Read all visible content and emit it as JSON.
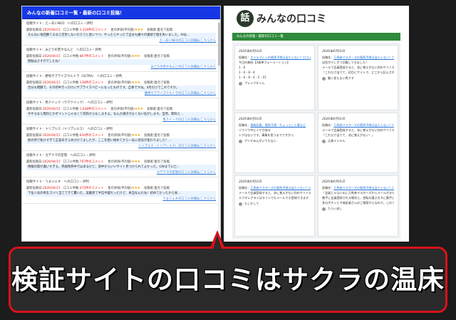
{
  "left_panel": {
    "header": "みんなの新着口コミ一覧・最新の口コミ投稿！",
    "posts": [
      {
        "site_line": "投稿サイト：えーあいNEO　への口コミ・評判",
        "date_label": "最新投稿日:",
        "date": "2026/04/15",
        "count_label": "口コミ件数:",
        "count": "1,316件のコメント",
        "rating_label": "星の評価(平均値)",
        "stars": "★★★",
        "poster": "投稿者:匿名で投稿",
        "body": "そんなに毎回勝てるなら苦労しないだろうと思いつつ、やったらやったで自分も嬉々の連続で億を失いました。AIは…",
        "link": "えーあいNEOの口コミ詳細は/こちらから"
      },
      {
        "site_line": "投稿サイト：みどりの若やなんど　への口コミ・評判",
        "date_label": "最新投稿日:",
        "date": "2026/04/15",
        "count_label": "口コミ件数:",
        "count": "867件のコメント",
        "rating_label": "星の評価(平均値)",
        "stars": "★★★",
        "poster": "投稿者:匿名で投稿",
        "body": "無駄はさすがでしたね！",
        "link": "みどりの若やなんどの口コミ詳細は/こちらから"
      },
      {
        "site_line": "投稿サイト：勝馬サプライズウルトラ（ULTRA）　への口コミ・評判",
        "date_label": "最新投稿日:",
        "date": "2026/04/15",
        "count_label": "口コミ件数:",
        "count": "138件のコメント",
        "rating_label": "星の評価(平均値)",
        "stars": "★★★",
        "poster": "投稿者:匿名で投稿",
        "body": "合分も問題で、その的中きっかけにサプライズベビーになったものです。自体ですね。4月だけでこれですか。",
        "link": "勝馬サプライズウルトラの口コミ詳細は/こちらから"
      },
      {
        "site_line": "投稿サイト：馬クイック（ウマクイック）　への口コミ・評判",
        "date_label": "最新投稿日:",
        "date": "2026/04/15",
        "count_label": "口コミ件数:",
        "count": "1,648件のコメント",
        "rating_label": "星の評価(平均値)",
        "stars": "★★★",
        "poster": "投稿者:匿名で投稿",
        "body": "今やるなら無料とかポイントじゃなくて有料からもしますよ。なんか調子がよくない気がします。当然、無料と…",
        "link": "馬クイックの口コミ詳細は/こちらから"
      },
      {
        "site_line": "投稿サイト：トリプルス（トリプレエス）　への口コミ・評判",
        "date_label": "最新投稿日:",
        "date": "2026/04/15",
        "count_label": "口コミ件数:",
        "count": "650件のコメント",
        "rating_label": "星の評価(平均値)",
        "stars": "★★★",
        "poster": "投稿者:匿名で投稿",
        "body": "他の所で負けすぎて正直あきらめかけてましたが、ここを使い始めてから一気に状況が変わりました！…",
        "link": "トリプルス（トリプレエス）の口コミ詳細は/こちらから"
      },
      {
        "site_line": "投稿サイト：カデクマの定理　への口コミ・評判",
        "date_label": "最新投稿日:",
        "date": "2026/04/15",
        "count_label": "口コミ件数:",
        "count": "767件のコメント",
        "rating_label": "星の評価(平均値)",
        "stars": "★★★",
        "poster": "投稿者:匿名で投稿",
        "body": "情報の質が違いすぎる。券面馬券中ではあるけど、途中からいいサイト見つけられてよかった。GWまでに亡…",
        "link": "カデクマの定理の口コミ詳細は/こちらから"
      },
      {
        "site_line": "投稿サイト：うまジェネ　への口コミ・評判",
        "date_label": "最新投稿日:",
        "date": "2026/04/15",
        "count_label": "口コミ件数:",
        "count": "472件のコメント",
        "rating_label": "星の評価(平均値)",
        "stars": "★★★",
        "poster": "投稿者:匿名で投稿",
        "body": "下位人気の馬をズバリ当ててきて驚いた。実績見て半信半疑だったけど、本当なんだね！初めてだったから食…",
        "link": "うまジェネの口コミ詳細は/こちらから"
      }
    ]
  },
  "right_panel": {
    "logo_glyph": "話",
    "site_title": "みんなの口コミ",
    "section_bar": "みんなの新着・最新の口コミ一覧",
    "cards": [
      {
        "date": "2026年4月16日",
        "lines": [
          {
            "pre": "投稿先：",
            "link": "オイルマシンの競馬予想は当たらない？口コミ評判や無料予想の検証を公開！"
          },
          {
            "pre": "今日の無料【3連単フォーメーション】",
            "link": ""
          },
          {
            "pre": "1 - 6",
            "link": ""
          },
          {
            "pre": "1 - 6 - 8 - 4",
            "link": ""
          },
          {
            "pre": "1 - 6 - 8 - 4 - 5 - 15",
            "link": ""
          }
        ],
        "user": "ブレイクタイム"
      },
      {
        "date": "2026年4月16日",
        "lines": [
          {
            "pre": "投稿先：",
            "link": "万馬券マスターズの競馬予想は当たらない？口コミ評判や無料予想の検証を公開！"
          },
          {
            "pre": "自信が少しずつ回復してきました！",
            "link": ""
          },
          {
            "pre": "メールで会員登録すると、非に覚えがない別のサイトからメールが来るのはよくありますね",
            "link": ""
          },
          {
            "pre": "「これだけ当てて、初月にサイトで、どこから記入されたか分かりません。競馬、サイト登録はやりません。",
            "link": ""
          }
        ],
        "user": "働く逆えない馬です"
      },
      {
        "date": "2026年4月16日",
        "lines": [
          {
            "pre": "投稿先：",
            "link": "情報収集：競馬予想・ちょっとした事など"
          },
          {
            "pre": "ゾクゾク中にトゲがある",
            "link": ""
          },
          {
            "pre": "トゲはないです。事業を思うまでですから",
            "link": ""
          }
        ],
        "user": "アンチみんがいでもない"
      },
      {
        "date": "2026年4月16日",
        "lines": [
          {
            "pre": "投稿先：",
            "link": "万馬券マスターズの競馬予想は当たらない？口コミ評判や無料予想の検証を公開！"
          },
          {
            "pre": "メールで会員登録すると、非に覚えがない別のサイトからメールが来るのはよくあります。",
            "link": ""
          },
          {
            "pre": "「これだけ当てて、非に覚えがない！」",
            "link": ""
          }
        ],
        "user": "元資メンテル"
      },
      {
        "date": "2026年4月16日",
        "lines": [
          {
            "pre": "投稿先：",
            "link": "万馬券マスターズの競馬予想は当たらない？口コミ評判や無料予想の検証を公開！"
          },
          {
            "pre": "メールで会員登録すると、非に覚えがない別のサイトからメールが来るのはよくあります。ラインではそれがないです。",
            "link": ""
          },
          {
            "pre": "エフラレグランはラインでもメールでも登録できます",
            "link": ""
          }
        ],
        "user": "もしかして"
      },
      {
        "date": "2026年4月16日",
        "lines": [
          {
            "pre": "投稿先：",
            "link": "万馬券マスターズの競馬予想は当たらない？口コミ評判や無料予想の検証を公開！"
          },
          {
            "pre": "「会員じゃないのに万馬券マスターズからメールがきたってどこですか？",
            "link": ""
          },
          {
            "pre": "勝手に会員登録される場合と、逆転の選ぶ方々に勝手に会員登録され新規会の場合が多いです。",
            "link": ""
          },
          {
            "pre": "多分ボチンとオ検証者さんのご検索からなので。このブログは会員限定の情報で使い捨しかし",
            "link": ""
          }
        ],
        "user": "たらい送し"
      }
    ]
  },
  "caption": {
    "text": "検証サイトの口コミはサクラの温床"
  },
  "colors": {
    "left_header": "#1537e6",
    "green_bar": "#2f8a3b",
    "caption_border": "#d6121a",
    "caption_bg": "#2a2a2a",
    "date_red": "#e01a1a",
    "link_blue": "#2a76d9"
  }
}
